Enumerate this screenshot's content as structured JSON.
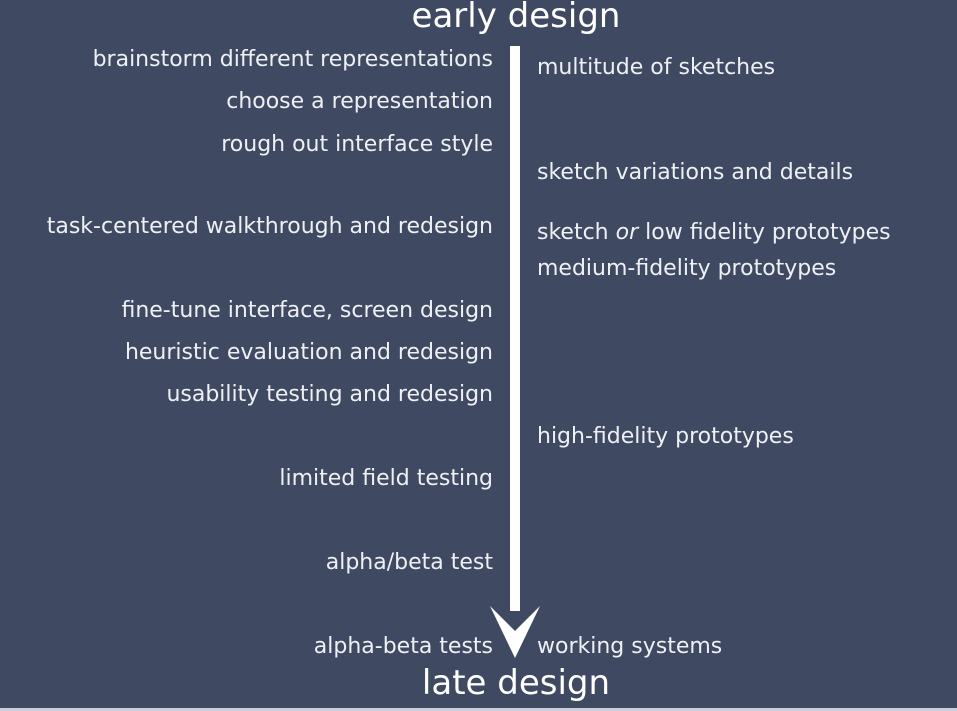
{
  "title_top": "early design",
  "title_bottom": "late design",
  "left_items": [
    "brainstorm different representations",
    "choose a representation",
    "rough out interface style",
    "task-centered walkthrough and redesign",
    "fine-tune interface, screen design",
    "heuristic evaluation and redesign",
    "usability testing and redesign",
    "limited field testing",
    "alpha/beta test",
    "alpha-beta tests"
  ],
  "right_items": [
    "multitude of sketches",
    "sketch variations and details",
    {
      "before": "sketch ",
      "emphasis": "or",
      "after": " low fidelity prototypes"
    },
    "medium-fidelity prototypes",
    "high-fidelity prototypes",
    "working systems"
  ],
  "colors": {
    "background": "#3f4a62",
    "text": "#eef0f4",
    "arrow": "#ffffff"
  }
}
